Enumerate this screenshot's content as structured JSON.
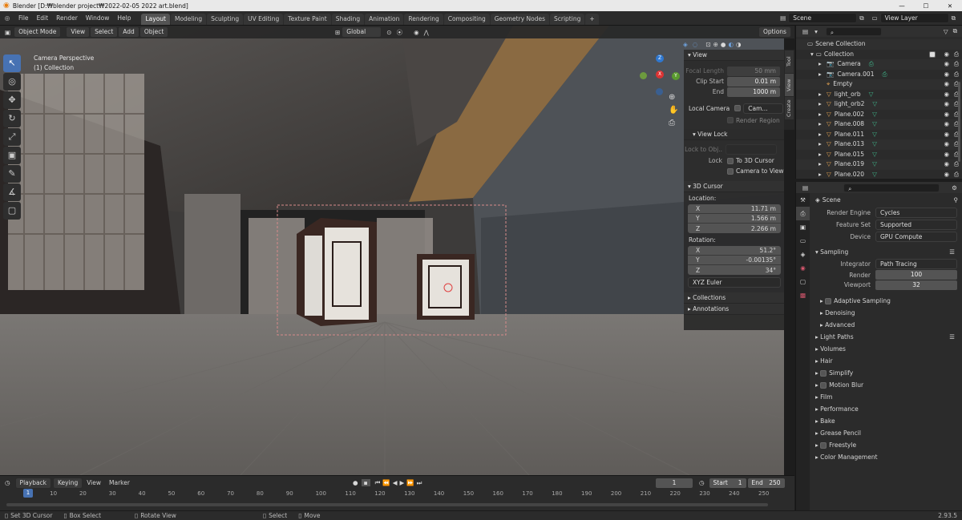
{
  "window": {
    "title": "Blender [D:₩blender project₩2022-02-05 2022 art.blend]",
    "minimize": "—",
    "maximize": "☐",
    "close": "✕"
  },
  "menu": [
    "File",
    "Edit",
    "Render",
    "Window",
    "Help"
  ],
  "workspaces": [
    "Layout",
    "Modeling",
    "Sculpting",
    "UV Editing",
    "Texture Paint",
    "Shading",
    "Animation",
    "Rendering",
    "Compositing",
    "Geometry Nodes",
    "Scripting",
    "+"
  ],
  "scene": {
    "label": "Scene",
    "view_layer": "View Layer"
  },
  "viewport_header": {
    "mode": "Object Mode",
    "menus": [
      "View",
      "Select",
      "Add",
      "Object"
    ],
    "orientation": "Global",
    "options": "Options"
  },
  "viewport": {
    "camera_label": "Camera Perspective",
    "collection_label": "(1) Collection",
    "gizmo_axes": [
      "Z",
      "X",
      "Y"
    ]
  },
  "tools": [
    {
      "icon": "cursor-select-icon",
      "glyph": "↖"
    },
    {
      "icon": "3d-cursor-icon",
      "glyph": "◎"
    },
    {
      "icon": "move-icon",
      "glyph": "✥"
    },
    {
      "icon": "rotate-icon",
      "glyph": "↻"
    },
    {
      "icon": "scale-icon",
      "glyph": "⤢"
    },
    {
      "icon": "transform-icon",
      "glyph": "▣"
    },
    {
      "icon": "annotate-icon",
      "glyph": "✎"
    },
    {
      "icon": "measure-icon",
      "glyph": "∡"
    },
    {
      "icon": "add-cube-icon",
      "glyph": "▢"
    }
  ],
  "npanel": {
    "view": {
      "title": "View",
      "focal_length_label": "Focal Length",
      "focal_length": "50 mm",
      "clip_start_label": "Clip Start",
      "clip_start": "0.01 m",
      "end_label": "End",
      "clip_end": "1000 m",
      "local_camera_label": "Local Camera",
      "local_camera_value": "Cam...",
      "render_region": "Render Region",
      "view_lock_title": "View Lock",
      "lock_to_obj": "Lock to Obj..",
      "lock_label": "Lock",
      "to_3d_cursor": "To 3D Cursor",
      "camera_to_view": "Camera to View"
    },
    "cursor": {
      "title": "3D Cursor",
      "location_label": "Location:",
      "location": [
        {
          "axis": "X",
          "value": "11.71 m"
        },
        {
          "axis": "Y",
          "value": "1.566 m"
        },
        {
          "axis": "Z",
          "value": "2.266 m"
        }
      ],
      "rotation_label": "Rotation:",
      "rotation": [
        {
          "axis": "X",
          "value": "51.2°"
        },
        {
          "axis": "Y",
          "value": "-0.00135°"
        },
        {
          "axis": "Z",
          "value": "34°"
        }
      ],
      "rotation_mode": "XYZ Euler"
    },
    "collections": "Collections",
    "annotations": "Annotations",
    "side_tabs": [
      "Tool",
      "View",
      "Create"
    ]
  },
  "outliner": {
    "root": "Scene Collection",
    "collection": "Collection",
    "items": [
      {
        "name": "Camera",
        "kind": "camera"
      },
      {
        "name": "Camera.001",
        "kind": "camera"
      },
      {
        "name": "Empty",
        "kind": "empty"
      },
      {
        "name": "light_orb",
        "kind": "mesh"
      },
      {
        "name": "light_orb2",
        "kind": "mesh"
      },
      {
        "name": "Plane.002",
        "kind": "mesh"
      },
      {
        "name": "Plane.008",
        "kind": "mesh"
      },
      {
        "name": "Plane.011",
        "kind": "mesh"
      },
      {
        "name": "Plane.013",
        "kind": "mesh"
      },
      {
        "name": "Plane.015",
        "kind": "mesh"
      },
      {
        "name": "Plane.019",
        "kind": "mesh"
      },
      {
        "name": "Plane.020",
        "kind": "mesh"
      }
    ]
  },
  "properties": {
    "scene": "Scene",
    "render_engine_label": "Render Engine",
    "render_engine": "Cycles",
    "feature_set_label": "Feature Set",
    "feature_set": "Supported",
    "device_label": "Device",
    "device": "GPU Compute",
    "sampling": "Sampling",
    "integrator_label": "Integrator",
    "integrator": "Path Tracing",
    "render_label": "Render",
    "render_samples": "100",
    "viewport_label": "Viewport",
    "viewport_samples": "32",
    "adaptive_sampling": "Adaptive Sampling",
    "denoising": "Denoising",
    "advanced": "Advanced",
    "panels": [
      {
        "label": "Light Paths",
        "checkbox": false
      },
      {
        "label": "Volumes",
        "checkbox": false
      },
      {
        "label": "Hair",
        "checkbox": false
      },
      {
        "label": "Simplify",
        "checkbox": true
      },
      {
        "label": "Motion Blur",
        "checkbox": true
      },
      {
        "label": "Film",
        "checkbox": false
      },
      {
        "label": "Performance",
        "checkbox": false
      },
      {
        "label": "Bake",
        "checkbox": false
      },
      {
        "label": "Grease Pencil",
        "checkbox": false
      },
      {
        "label": "Freestyle",
        "checkbox": true
      },
      {
        "label": "Color Management",
        "checkbox": false
      }
    ]
  },
  "timeline": {
    "menus": [
      "Playback",
      "Keying",
      "View",
      "Marker"
    ],
    "current_frame": "1",
    "start_label": "Start",
    "start": "1",
    "end_label": "End",
    "end": "250",
    "ticks": [
      "1",
      "10",
      "20",
      "30",
      "40",
      "50",
      "60",
      "70",
      "80",
      "90",
      "100",
      "110",
      "120",
      "130",
      "140",
      "150",
      "160",
      "170",
      "180",
      "190",
      "200",
      "210",
      "220",
      "230",
      "240",
      "250"
    ]
  },
  "statusbar": {
    "items": [
      "Set 3D Cursor",
      "Box Select",
      "Rotate View",
      "Select",
      "Move"
    ],
    "version": "2.93.5"
  }
}
